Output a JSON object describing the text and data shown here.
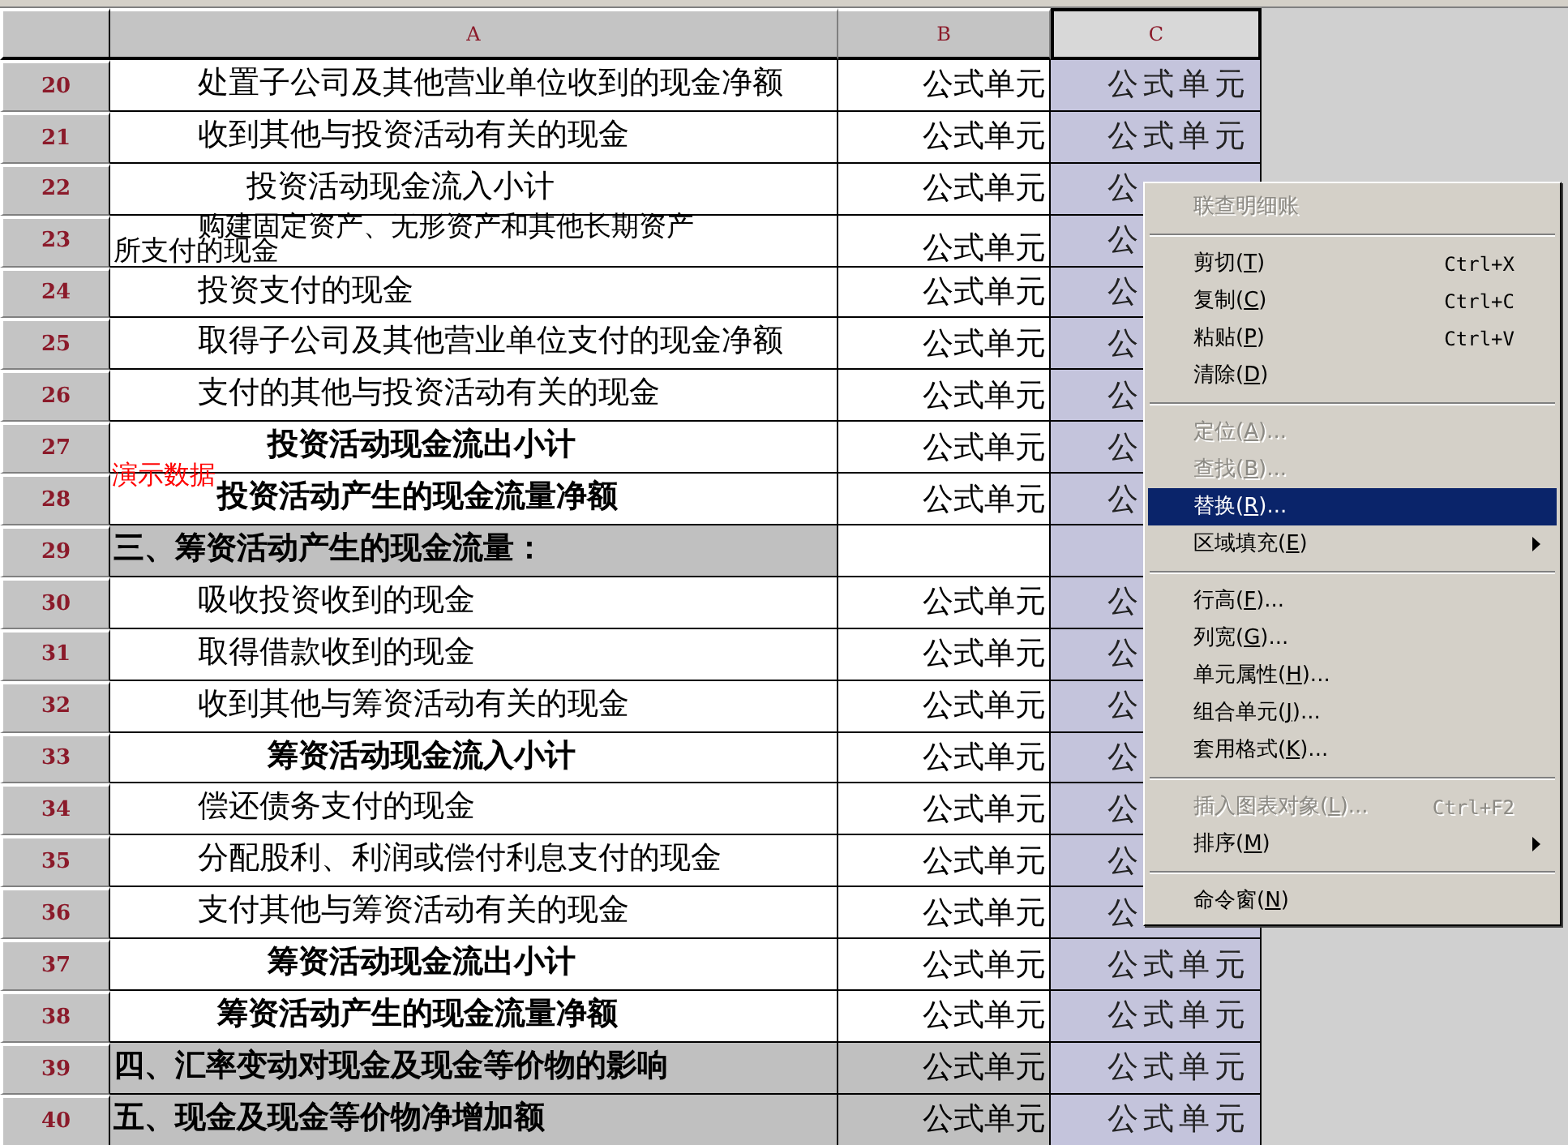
{
  "columns": [
    {
      "label": "A",
      "selected": false
    },
    {
      "label": "B",
      "selected": false
    },
    {
      "label": "C",
      "selected": true
    }
  ],
  "rows": [
    {
      "num": "20",
      "kind": "item",
      "a": [
        "处置子公司及其他营业单位收到的现金净额"
      ],
      "b": "公式单元",
      "c": "公式单元"
    },
    {
      "num": "21",
      "kind": "item",
      "a": [
        "收到其他与投资活动有关的现金"
      ],
      "b": "公式单元",
      "c": "公式单元"
    },
    {
      "num": "22",
      "kind": "inflow",
      "a": [
        "投资活动现金流入小计"
      ],
      "b": "公式单元",
      "c": "公"
    },
    {
      "num": "23",
      "kind": "item",
      "a": [
        "购建固定资产、无形资产和其他长期资产",
        "所支付的现金"
      ],
      "b": "公式单元",
      "c": "公"
    },
    {
      "num": "24",
      "kind": "item",
      "a": [
        "投资支付的现金"
      ],
      "b": "公式单元",
      "c": "公"
    },
    {
      "num": "25",
      "kind": "item",
      "a": [
        "取得子公司及其他营业单位支付的现金净额"
      ],
      "b": "公式单元",
      "c": "公"
    },
    {
      "num": "26",
      "kind": "item",
      "a": [
        "支付的其他与投资活动有关的现金"
      ],
      "b": "公式单元",
      "c": "公"
    },
    {
      "num": "27",
      "kind": "subtotal",
      "a": [
        "投资活动现金流出小计"
      ],
      "b": "公式单元",
      "c": "公"
    },
    {
      "num": "28",
      "kind": "net",
      "a": [
        "投资活动产生的现金流量净额"
      ],
      "b": "公式单元",
      "c": "公",
      "overlay": "演示数据"
    },
    {
      "num": "29",
      "kind": "section",
      "a": [
        "三、筹资活动产生的现金流量："
      ]
    },
    {
      "num": "30",
      "kind": "item",
      "a": [
        "吸收投资收到的现金"
      ],
      "b": "公式单元",
      "c": "公"
    },
    {
      "num": "31",
      "kind": "item",
      "a": [
        "取得借款收到的现金"
      ],
      "b": "公式单元",
      "c": "公"
    },
    {
      "num": "32",
      "kind": "item",
      "a": [
        "收到其他与筹资活动有关的现金"
      ],
      "b": "公式单元",
      "c": "公"
    },
    {
      "num": "33",
      "kind": "subtotal",
      "a": [
        "筹资活动现金流入小计"
      ],
      "b": "公式单元",
      "c": "公"
    },
    {
      "num": "34",
      "kind": "item",
      "a": [
        "偿还债务支付的现金"
      ],
      "b": "公式单元",
      "c": "公"
    },
    {
      "num": "35",
      "kind": "item",
      "a": [
        "分配股利、利润或偿付利息支付的现金"
      ],
      "b": "公式单元",
      "c": "公"
    },
    {
      "num": "36",
      "kind": "item",
      "a": [
        "支付其他与筹资活动有关的现金"
      ],
      "b": "公式单元",
      "c": "公"
    },
    {
      "num": "37",
      "kind": "subtotal",
      "a": [
        "筹资活动现金流出小计"
      ],
      "b": "公式单元",
      "c": "公式单元"
    },
    {
      "num": "38",
      "kind": "net",
      "a": [
        "筹资活动产生的现金流量净额"
      ],
      "b": "公式单元",
      "c": "公式单元"
    },
    {
      "num": "39",
      "kind": "section",
      "a": [
        "四、汇率变动对现金及现金等价物的影响"
      ],
      "b": "公式单元",
      "c": "公式单元"
    },
    {
      "num": "40",
      "kind": "section",
      "a": [
        "五、现金及现金等价物净增加额"
      ],
      "b": "公式单元",
      "c": "公式单元"
    }
  ],
  "context_menu": {
    "items": [
      {
        "kind": "item",
        "label": "联查明细账",
        "disabled": true,
        "selected": false
      },
      {
        "kind": "separator"
      },
      {
        "kind": "item",
        "label": "剪切(",
        "key": "T",
        "tail": ")",
        "shortcut": "Ctrl+X",
        "disabled": false,
        "selected": false
      },
      {
        "kind": "item",
        "label": "复制(",
        "key": "C",
        "tail": ")",
        "shortcut": "Ctrl+C",
        "disabled": false,
        "selected": false
      },
      {
        "kind": "item",
        "label": "粘贴(",
        "key": "P",
        "tail": ")",
        "shortcut": "Ctrl+V",
        "disabled": false,
        "selected": false
      },
      {
        "kind": "item",
        "label": "清除(",
        "key": "D",
        "tail": ")",
        "disabled": false,
        "selected": false
      },
      {
        "kind": "separator"
      },
      {
        "kind": "item",
        "label": "定位(",
        "key": "A",
        "tail": ")...",
        "disabled": true,
        "selected": false
      },
      {
        "kind": "item",
        "label": "查找(",
        "key": "B",
        "tail": ")...",
        "disabled": true,
        "selected": false
      },
      {
        "kind": "item",
        "label": "替换(",
        "key": "R",
        "tail": ")...",
        "disabled": false,
        "selected": true
      },
      {
        "kind": "item",
        "label": "区域填充(",
        "key": "E",
        "tail": ")",
        "submenu": true,
        "disabled": false,
        "selected": false
      },
      {
        "kind": "separator"
      },
      {
        "kind": "item",
        "label": "行高(",
        "key": "F",
        "tail": ")...",
        "disabled": false,
        "selected": false
      },
      {
        "kind": "item",
        "label": "列宽(",
        "key": "G",
        "tail": ")...",
        "disabled": false,
        "selected": false
      },
      {
        "kind": "item",
        "label": "单元属性(",
        "key": "H",
        "tail": ")...",
        "disabled": false,
        "selected": false
      },
      {
        "kind": "item",
        "label": "组合单元(",
        "key": "J",
        "tail": ")...",
        "disabled": false,
        "selected": false
      },
      {
        "kind": "item",
        "label": "套用格式(",
        "key": "K",
        "tail": ")...",
        "disabled": false,
        "selected": false
      },
      {
        "kind": "separator"
      },
      {
        "kind": "item",
        "label": "插入图表对象(",
        "key": "L",
        "tail": ")...",
        "shortcut": "Ctrl+F2",
        "disabled": true,
        "selected": false
      },
      {
        "kind": "item",
        "label": "排序(",
        "key": "M",
        "tail": ")",
        "submenu": true,
        "disabled": false,
        "selected": false
      },
      {
        "kind": "separator"
      },
      {
        "kind": "item",
        "label": "命令窗(",
        "key": "N",
        "tail": ")",
        "disabled": false,
        "selected": false
      }
    ]
  }
}
